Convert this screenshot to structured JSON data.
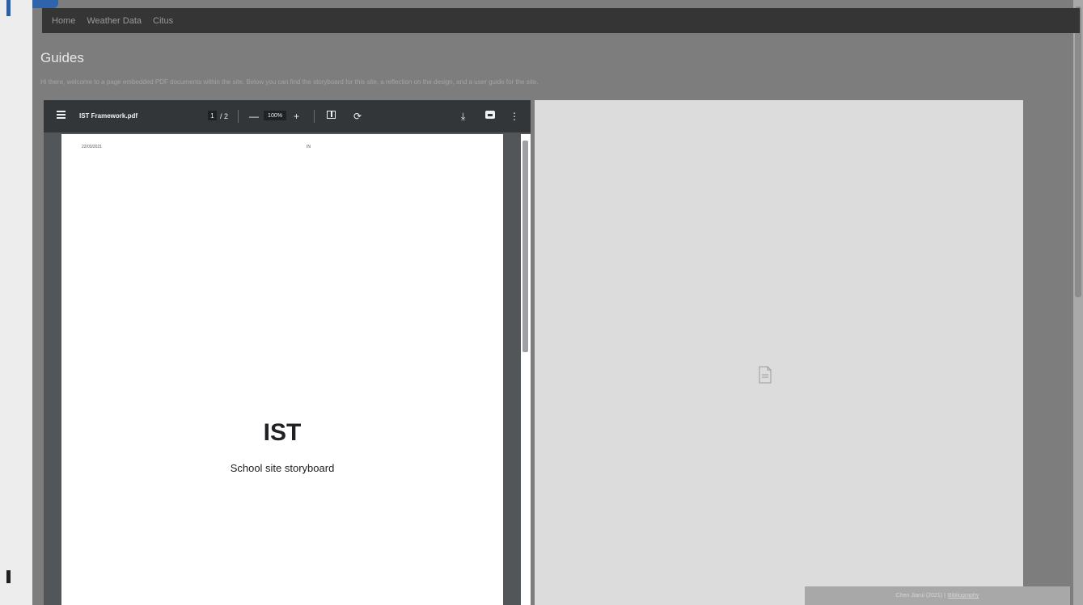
{
  "navbar": {
    "items": [
      {
        "label": "Home"
      },
      {
        "label": "Weather Data"
      },
      {
        "label": "Citus"
      }
    ]
  },
  "page": {
    "title": "Guides",
    "intro": "Hi there, welcome to a page embedded PDF documents within the site. Below you can find the storyboard for this site, a reflection on the design, and a user guide for the site."
  },
  "pdf_viewer": {
    "file_name": "IST Framework.pdf",
    "page_current": "1",
    "page_total": "/ 2",
    "zoom": "100%",
    "page": {
      "date": "22/03/2021",
      "page_number": "IN",
      "title": "IST",
      "subtitle": "School site storyboard"
    }
  },
  "footer": {
    "text": "Chen Jiarui (2021)",
    "link": "Bibliography"
  }
}
